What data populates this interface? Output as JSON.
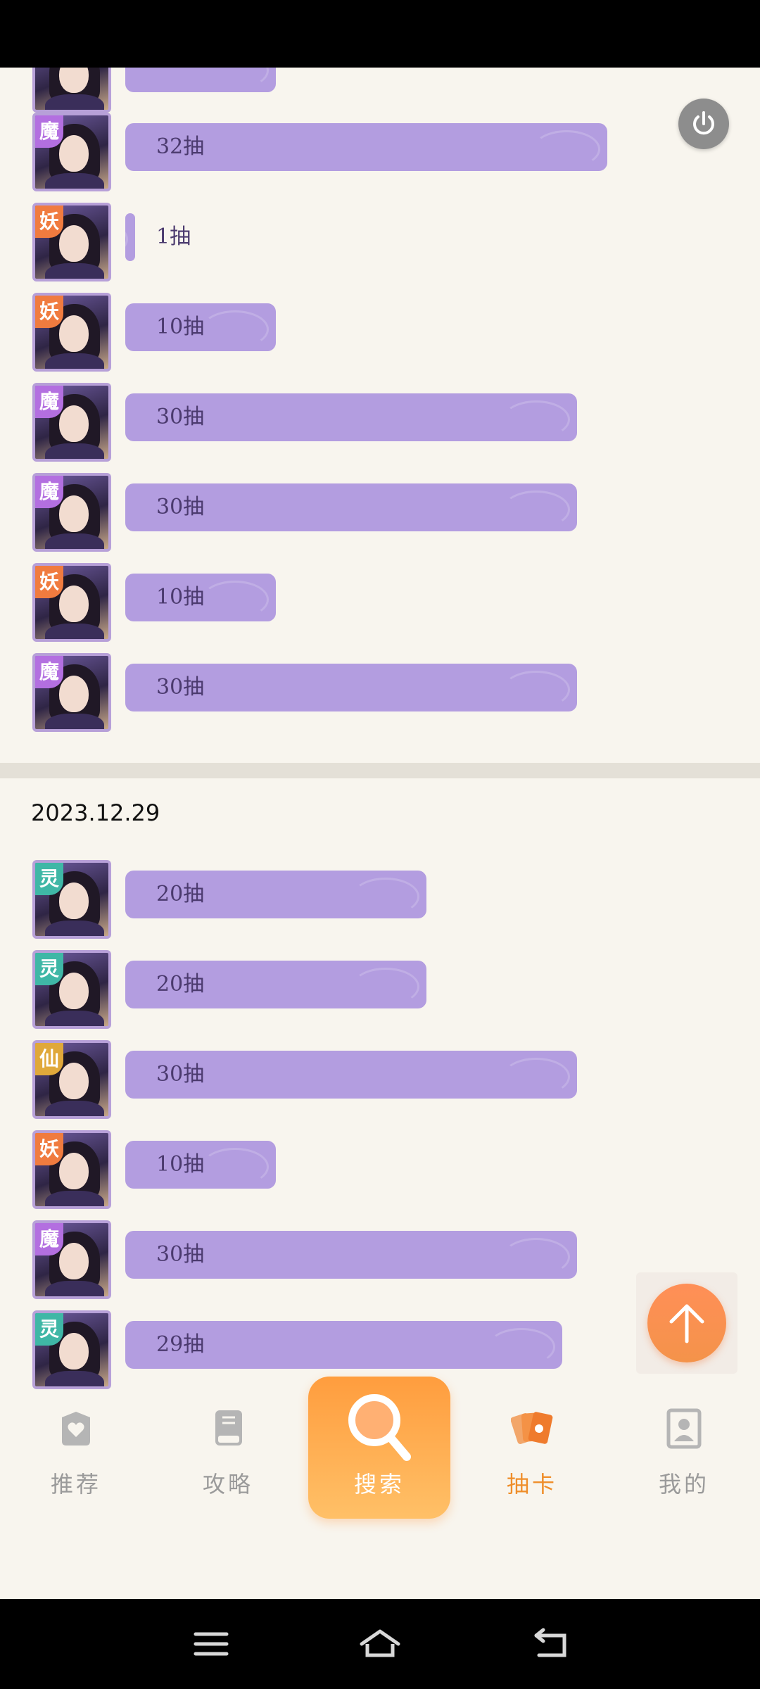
{
  "colors": {
    "accent_purple": "#b39de0",
    "accent_orange": "#ef8e2a",
    "background": "#f8f5ee"
  },
  "group1": {
    "rows": [
      {
        "faction": "魔",
        "faction_color": "#b36fe0",
        "draws_label": "32抽",
        "draws": 32
      },
      {
        "faction": "妖",
        "faction_color": "#f07b3f",
        "draws_label": "1抽",
        "draws": 1
      },
      {
        "faction": "妖",
        "faction_color": "#f07b3f",
        "draws_label": "10抽",
        "draws": 10
      },
      {
        "faction": "魔",
        "faction_color": "#b36fe0",
        "draws_label": "30抽",
        "draws": 30
      },
      {
        "faction": "魔",
        "faction_color": "#b36fe0",
        "draws_label": "30抽",
        "draws": 30
      },
      {
        "faction": "妖",
        "faction_color": "#f07b3f",
        "draws_label": "10抽",
        "draws": 10
      },
      {
        "faction": "魔",
        "faction_color": "#b36fe0",
        "draws_label": "30抽",
        "draws": 30
      }
    ]
  },
  "group2": {
    "date": "2023.12.29",
    "rows": [
      {
        "faction": "灵",
        "faction_color": "#3fb7a6",
        "draws_label": "20抽",
        "draws": 20
      },
      {
        "faction": "灵",
        "faction_color": "#3fb7a6",
        "draws_label": "20抽",
        "draws": 20
      },
      {
        "faction": "仙",
        "faction_color": "#e0a83a",
        "draws_label": "30抽",
        "draws": 30
      },
      {
        "faction": "妖",
        "faction_color": "#f07b3f",
        "draws_label": "10抽",
        "draws": 10
      },
      {
        "faction": "魔",
        "faction_color": "#b36fe0",
        "draws_label": "30抽",
        "draws": 30
      },
      {
        "faction": "灵",
        "faction_color": "#3fb7a6",
        "draws_label": "29抽",
        "draws": 29
      }
    ]
  },
  "icons": {
    "power": "power-icon",
    "scroll_top": "arrow-up-icon",
    "search": "search-icon"
  },
  "nav": {
    "items": [
      {
        "label": "推荐",
        "icon": "heart-box-icon"
      },
      {
        "label": "攻略",
        "icon": "book-icon"
      },
      {
        "label": "搜索",
        "icon": "search-icon"
      },
      {
        "label": "抽卡",
        "icon": "cards-icon",
        "active": true
      },
      {
        "label": "我的",
        "icon": "profile-icon"
      }
    ]
  }
}
